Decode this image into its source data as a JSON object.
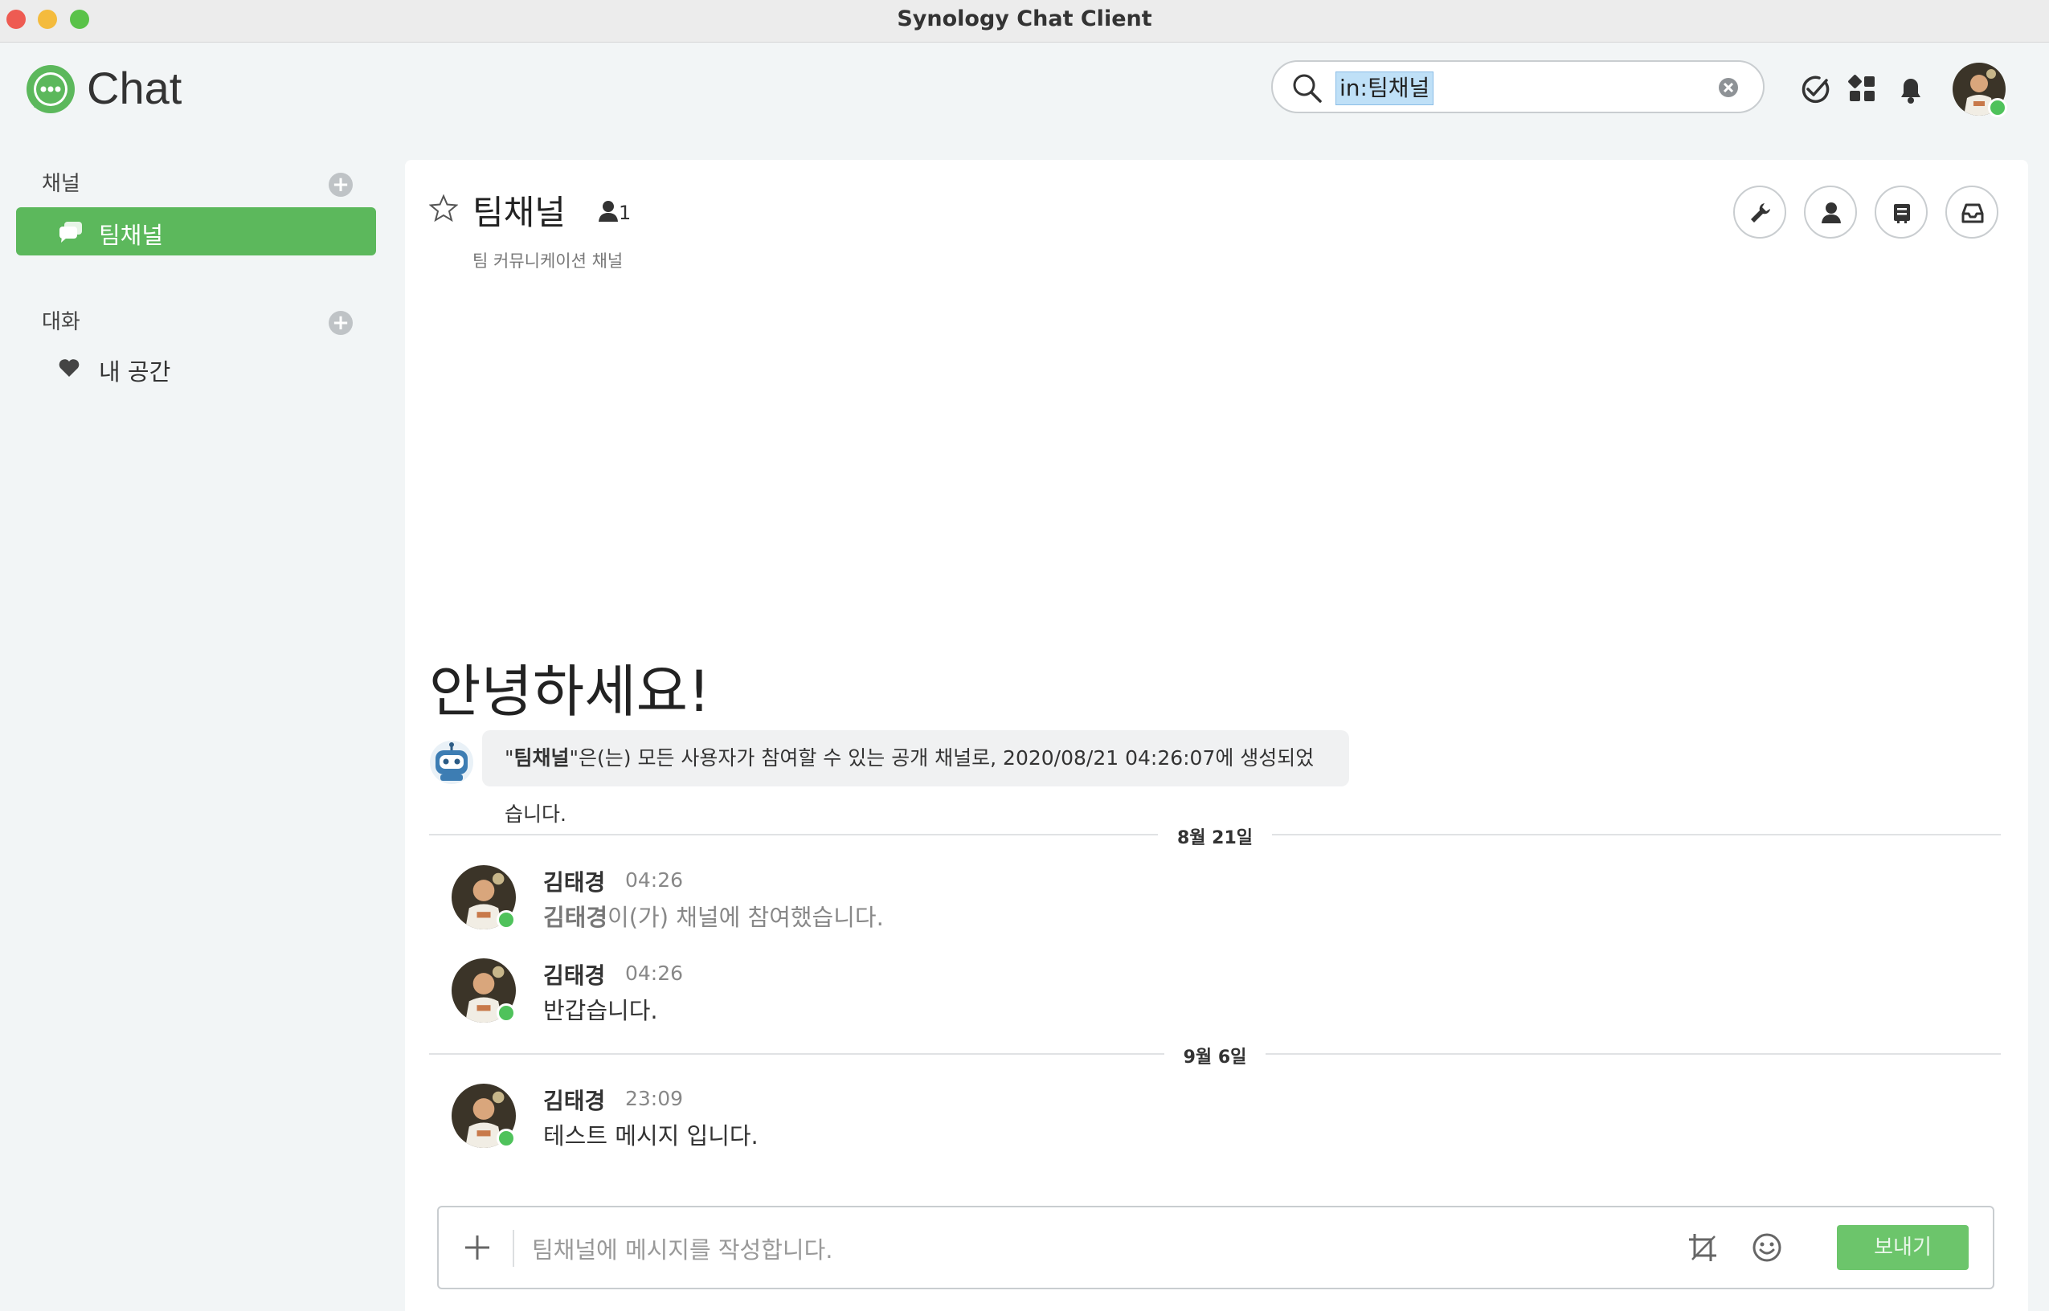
{
  "window": {
    "title": "Synology Chat Client"
  },
  "header": {
    "app_name": "Chat",
    "search": {
      "value": "in:팀채널",
      "icon": "search-icon"
    },
    "icons": [
      "check-circle-icon",
      "apps-icon",
      "bell-icon"
    ]
  },
  "sidebar": {
    "channels_title": "채널",
    "channels": [
      {
        "label": "팀채널",
        "icon": "channel-icon",
        "active": true
      }
    ],
    "conversations_title": "대화",
    "conversations": [
      {
        "label": "내 공간",
        "icon": "heart-icon"
      }
    ]
  },
  "channel": {
    "name": "팀채널",
    "member_count": "1",
    "description": "팀 커뮤니케이션 채널",
    "tools": [
      "wrench-icon",
      "person-icon",
      "board-icon",
      "inbox-icon"
    ]
  },
  "timeline": {
    "greeting": "안녕하세요!",
    "system_message": {
      "channel": "팀채널",
      "text_prefix": "\"",
      "text_suffix": "\"은(는) 모든 사용자가 참여할 수 있는 공개 채널로, 2020/08/21 04:26:07에 생성되었습니다."
    },
    "dates": [
      "8월 21일",
      "9월 6일"
    ],
    "messages": [
      {
        "name": "김태경",
        "time": "04:26",
        "sys_name": "김태경",
        "sys_text": "이(가) 채널에 참여했습니다."
      },
      {
        "name": "김태경",
        "time": "04:26",
        "text": "반갑습니다."
      },
      {
        "name": "김태경",
        "time": "23:09",
        "text": "테스트 메시지 입니다."
      }
    ]
  },
  "composer": {
    "placeholder": "팀채널에 메시지를 작성합니다.",
    "send_label": "보내기"
  },
  "colors": {
    "accent": "#5cb85c",
    "send": "#6cc56b",
    "online": "#4fc25b"
  }
}
